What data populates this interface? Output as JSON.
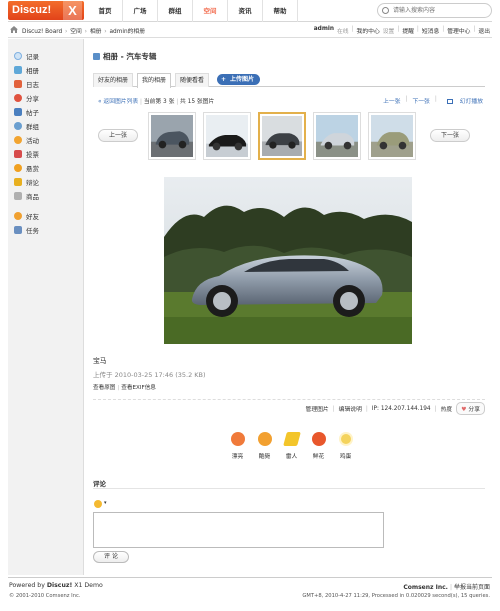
{
  "header": {
    "logo_text": "Discuz!",
    "logo_mark": "X",
    "nav": [
      "首页",
      "广场",
      "群组",
      "空间",
      "资讯",
      "帮助"
    ],
    "nav_active_index": 3,
    "search_placeholder": "请输入搜索内容"
  },
  "breadcrumb": {
    "items": [
      "Discuz! Board",
      "空间",
      "相册",
      "admin的相册"
    ],
    "separator": "›"
  },
  "usermenu": {
    "username": "admin",
    "status": "在线",
    "items": [
      "我的中心",
      "设置",
      "提醒",
      "短消息",
      "管理中心",
      "退出"
    ]
  },
  "sidebar": {
    "items": [
      {
        "label": "记录",
        "icon": "record-icon",
        "color": "#7fb0e0"
      },
      {
        "label": "相册",
        "icon": "album-icon",
        "color": "#5fa8d8"
      },
      {
        "label": "日志",
        "icon": "blog-icon",
        "color": "#e2623c"
      },
      {
        "label": "分享",
        "icon": "share-icon",
        "color": "#e0533f"
      },
      {
        "label": "帖子",
        "icon": "thread-icon",
        "color": "#4a7fbf"
      },
      {
        "label": "群组",
        "icon": "group-icon",
        "color": "#6a9fd0"
      },
      {
        "label": "活动",
        "icon": "activity-icon",
        "color": "#f2a430"
      },
      {
        "label": "投票",
        "icon": "poll-icon",
        "color": "#d74b4b"
      },
      {
        "label": "悬赏",
        "icon": "reward-icon",
        "color": "#f0a020"
      },
      {
        "label": "辩论",
        "icon": "debate-icon",
        "color": "#e8b020"
      },
      {
        "label": "商品",
        "icon": "goods-icon",
        "color": "#b0b0b0"
      },
      {
        "label": "好友",
        "icon": "friends-icon",
        "color": "#f0a030"
      },
      {
        "label": "任务",
        "icon": "task-icon",
        "color": "#6a8fc0"
      }
    ]
  },
  "page": {
    "title": "相册 - 汽车专辑",
    "tabs": [
      "好友的相册",
      "我的相册",
      "随便看看"
    ],
    "active_tab_index": 1,
    "upload_label": "上传图片",
    "back_link": "返回图片列表",
    "position_text": "当前第 3 张",
    "total_text": "共 15 张图片",
    "prev_link": "上一张",
    "next_link": "下一张",
    "slideshow_link": "幻灯播放",
    "prev_button": "上一张",
    "next_button": "下一张"
  },
  "photo": {
    "title": "宝马",
    "uploaded_text": "上传于 2010-03-25 17:46 (35.2 KB)",
    "links": [
      "查看原图",
      "查看EXIF信息"
    ],
    "thumbnail_count": 5,
    "selected_thumbnail_index": 2
  },
  "actions": {
    "manage": "管理图片",
    "edit_desc": "编辑说明",
    "ip_text": "IP: 124.207.144.194",
    "hot_label": "热度",
    "share_label": "分享"
  },
  "emotions": [
    {
      "label": "漂亮",
      "icon": "pretty-face-icon",
      "color": "#f07a3a"
    },
    {
      "label": "酷毙",
      "icon": "cool-face-icon",
      "color": "#f2a030"
    },
    {
      "label": "雷人",
      "icon": "lightning-icon",
      "color": "#f3c52a"
    },
    {
      "label": "鲜花",
      "icon": "flower-icon",
      "color": "#e8572c"
    },
    {
      "label": "鸡蛋",
      "icon": "egg-icon",
      "color": "#f4d35c"
    }
  ],
  "comment": {
    "label": "评论",
    "submit_label": "评 论"
  },
  "footer": {
    "powered_prefix": "Powered by ",
    "powered_brand": "Discuz!",
    "powered_suffix": " X1 Demo",
    "copyright": "© 2001-2010 Comsenz Inc.",
    "company": "Comsenz Inc.",
    "report": "举报当前页面",
    "stats": "GMT+8, 2010-4-27 11:29, Processed in 0.020029 second(s), 15 queries."
  }
}
